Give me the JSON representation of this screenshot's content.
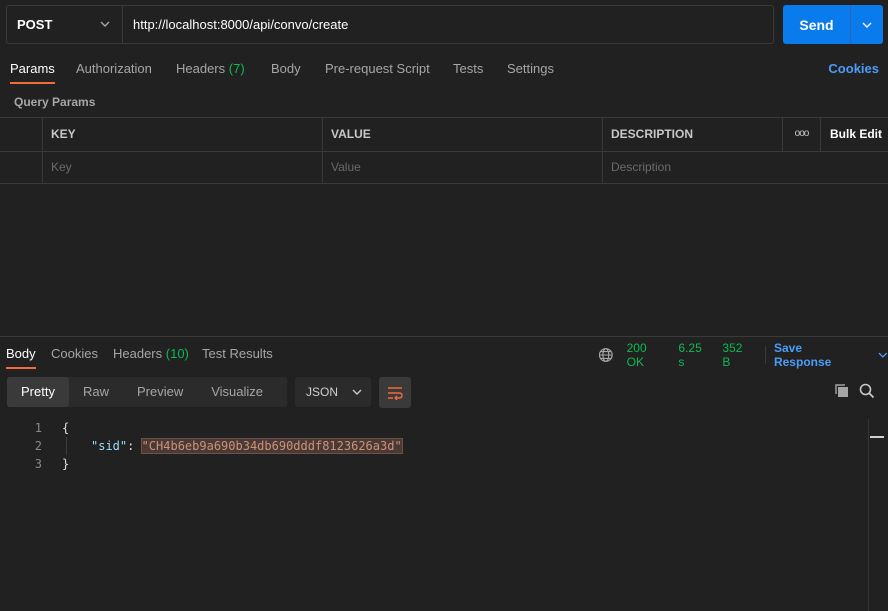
{
  "request": {
    "method": "POST",
    "url": "http://localhost:8000/api/convo/create",
    "send_label": "Send"
  },
  "request_tabs": {
    "params": "Params",
    "authorization": "Authorization",
    "headers": "Headers",
    "headers_count": "(7)",
    "body": "Body",
    "prerequest": "Pre-request Script",
    "tests": "Tests",
    "settings": "Settings",
    "cookies": "Cookies"
  },
  "query_params": {
    "title": "Query Params",
    "columns": {
      "key": "KEY",
      "value": "VALUE",
      "description": "DESCRIPTION",
      "bulk_edit": "Bulk Edit",
      "more": "ooo"
    },
    "placeholders": {
      "key": "Key",
      "value": "Value",
      "description": "Description"
    }
  },
  "response_tabs": {
    "body": "Body",
    "cookies": "Cookies",
    "headers": "Headers",
    "headers_count": "(10)",
    "test_results": "Test Results"
  },
  "status": {
    "code": "200 OK",
    "time": "6.25 s",
    "size": "352 B",
    "save_response": "Save Response"
  },
  "view": {
    "tabs": {
      "pretty": "Pretty",
      "raw": "Raw",
      "preview": "Preview",
      "visualize": "Visualize"
    },
    "format": "JSON"
  },
  "code": {
    "line_numbers": [
      "1",
      "2",
      "3"
    ],
    "open_brace": "{",
    "close_brace": "}",
    "key": "\"sid\"",
    "colon": ": ",
    "value": "\"CH4b6eb9a690b34db690dddf8123626a3d\""
  },
  "colors": {
    "accent": "#f26b3a",
    "send_blue": "#097bed",
    "status_green": "#0cbb52",
    "link_blue": "#4a9df8"
  }
}
